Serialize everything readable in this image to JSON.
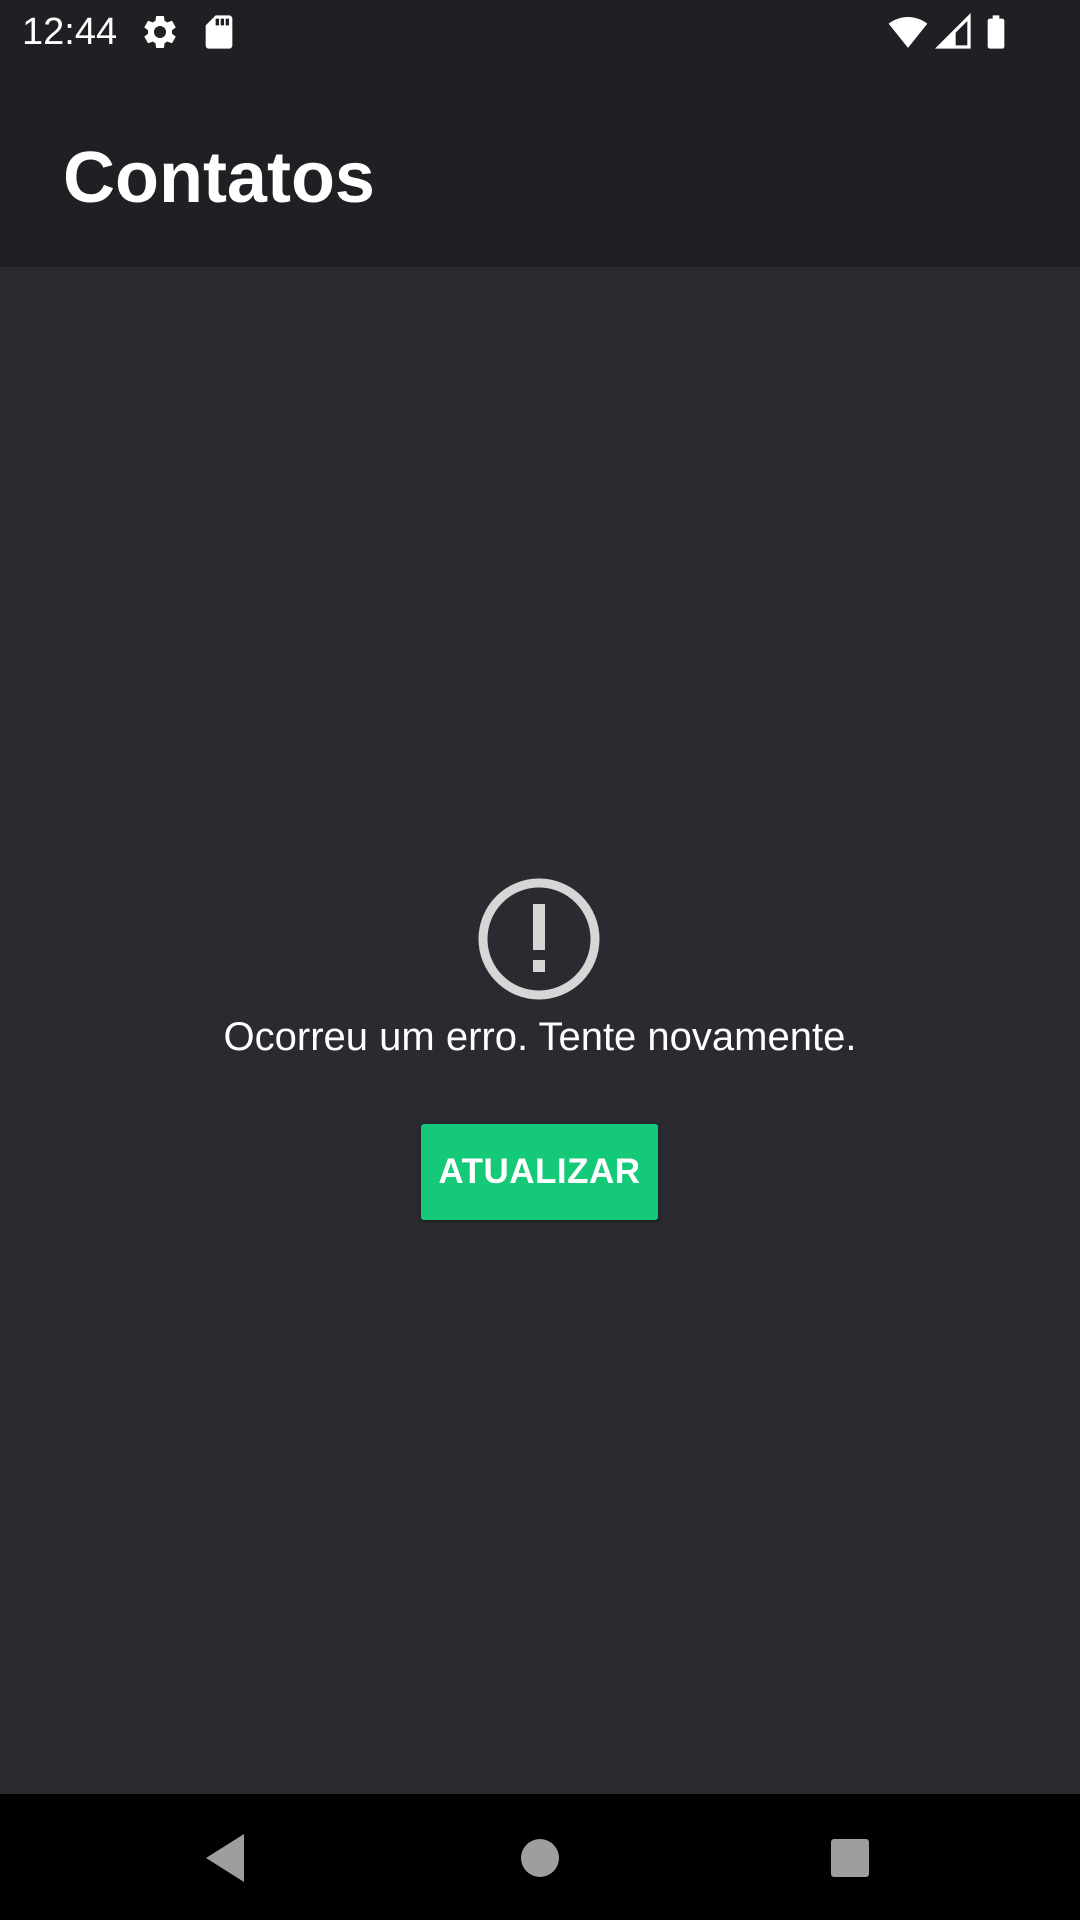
{
  "status_bar": {
    "time": "12:44",
    "icons": [
      "gear-icon",
      "sd-card-icon",
      "wifi-icon",
      "cell-signal-icon",
      "battery-icon"
    ]
  },
  "app_bar": {
    "title": "Contatos"
  },
  "error_state": {
    "icon": "error-circle-icon",
    "message": "Ocorreu um erro. Tente novamente.",
    "button_label": "ATUALIZAR"
  },
  "colors": {
    "status_bar_bg": "#1f2023",
    "app_bar_bg": "#1f2023",
    "content_bg": "#2a2b30",
    "accent": "#14c978",
    "icon_gray": "#d6d6d6",
    "nav_bar_bg": "#000000",
    "nav_icon": "#9e9e9e"
  },
  "nav_bar": {
    "buttons": [
      "back-icon",
      "home-icon",
      "recents-icon"
    ]
  }
}
